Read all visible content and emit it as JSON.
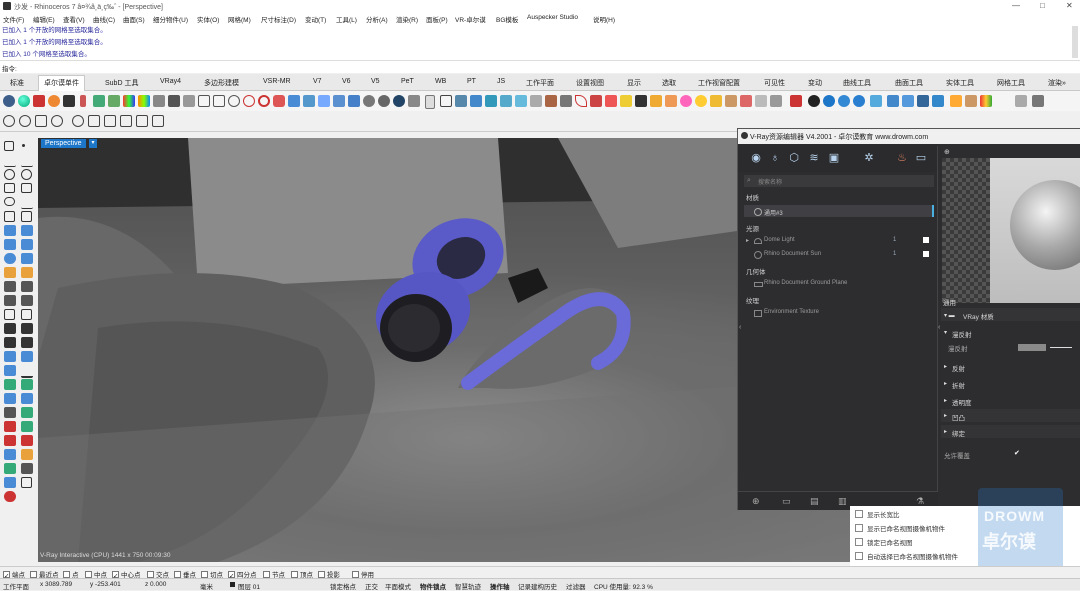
{
  "window": {
    "title": "沙发 - Rhinoceros 7 â¤¾â¸ä¸ç‰ˆ - [Perspective]",
    "controls": [
      "—",
      "□",
      "✕"
    ]
  },
  "menu": [
    "文件(F)",
    "编辑(E)",
    "查看(V)",
    "曲线(C)",
    "曲面(S)",
    "细分物件(U)",
    "实体(O)",
    "网格(M)",
    "尺寸标注(D)",
    "变动(T)",
    "工具(L)",
    "分析(A)",
    "渲染(R)",
    "面板(P)",
    "VR-卓尔谟",
    "BG模板",
    "Auspecker Studio",
    "说明(H)"
  ],
  "command_history": [
    "已加入 1 个开放的网格至选取集合。",
    "已加入 1 个开放的网格至选取集合。",
    "已加入 10 个网格至选取集合。"
  ],
  "command_prompt": "指令:",
  "tabs": [
    "标准",
    "卓尔谟单件",
    "SubD 工具",
    "VRay4",
    "多边形建模",
    "VSR-MR",
    "V7",
    "V6",
    "V5",
    "PeT",
    "WB",
    "PT",
    "JS",
    "工作平面",
    "设置视图",
    "显示",
    "选取",
    "工作视窗配置",
    "可见性",
    "变动",
    "曲线工具",
    "曲面工具",
    "实体工具",
    "网格工具",
    "渲染»"
  ],
  "active_tab": "卓尔谟单件",
  "viewport": {
    "label": "Perspective",
    "status": "V-Ray Interactive (CPU)    1441 x 750    00:09:30"
  },
  "vray": {
    "title": "V-Ray资源编辑器 V4.2001 - 卓尔谟教育 www.drowm.com",
    "search_placeholder": "搜索名称",
    "sections": {
      "materials": "材质",
      "lights": "光源",
      "geometry": "几何体",
      "textures": "纹理"
    },
    "material_item": "通用#3",
    "lights": [
      {
        "name": "Dome Light",
        "count": "1"
      },
      {
        "name": "Rhino Document Sun",
        "count": "1"
      }
    ],
    "geometry_item": "Rhino Document Ground Plane",
    "texture_item": "Environment Texture",
    "props": {
      "general": "通用",
      "material_header": "VRay 材质",
      "diffuse_section": "漫反射",
      "diffuse_label": "漫反射",
      "reflection": "反射",
      "refraction": "折射",
      "opacity": "透明度",
      "bump": "凹凸",
      "binding": "绑定",
      "allow_override": "允许覆盖"
    }
  },
  "named_views_options": [
    "显示长宽比",
    "显示已命名视图摄像机物件",
    "锁定已命名视图",
    "自动选择已命名视图摄像机物件"
  ],
  "watermark": {
    "line1": "DROWM",
    "line2": "卓尔谟"
  },
  "osnap": [
    "端点",
    "最近点",
    "点",
    "中点",
    "中心点",
    "交点",
    "垂点",
    "切点",
    "四分点",
    "节点",
    "顶点",
    "投影",
    "停用"
  ],
  "osnap_checked": [
    "端点",
    "中心点",
    "四分点"
  ],
  "status": {
    "cplane": "工作平面",
    "x": "x 3089.789",
    "y": "y -253.401",
    "z": "z 0.000",
    "unit": "毫米",
    "layer": "图层 01",
    "toggles": [
      "锁定格点",
      "正交",
      "平面模式",
      "物件锁点",
      "智慧轨迹",
      "操作轴",
      "记录建构历史",
      "过滤器"
    ],
    "cpu": "CPU 使用量: 92.3 %"
  },
  "colors": {
    "accent": "#1e76c8",
    "headphone": "#6a6ad8",
    "panel_dark": "#2d2d30"
  }
}
